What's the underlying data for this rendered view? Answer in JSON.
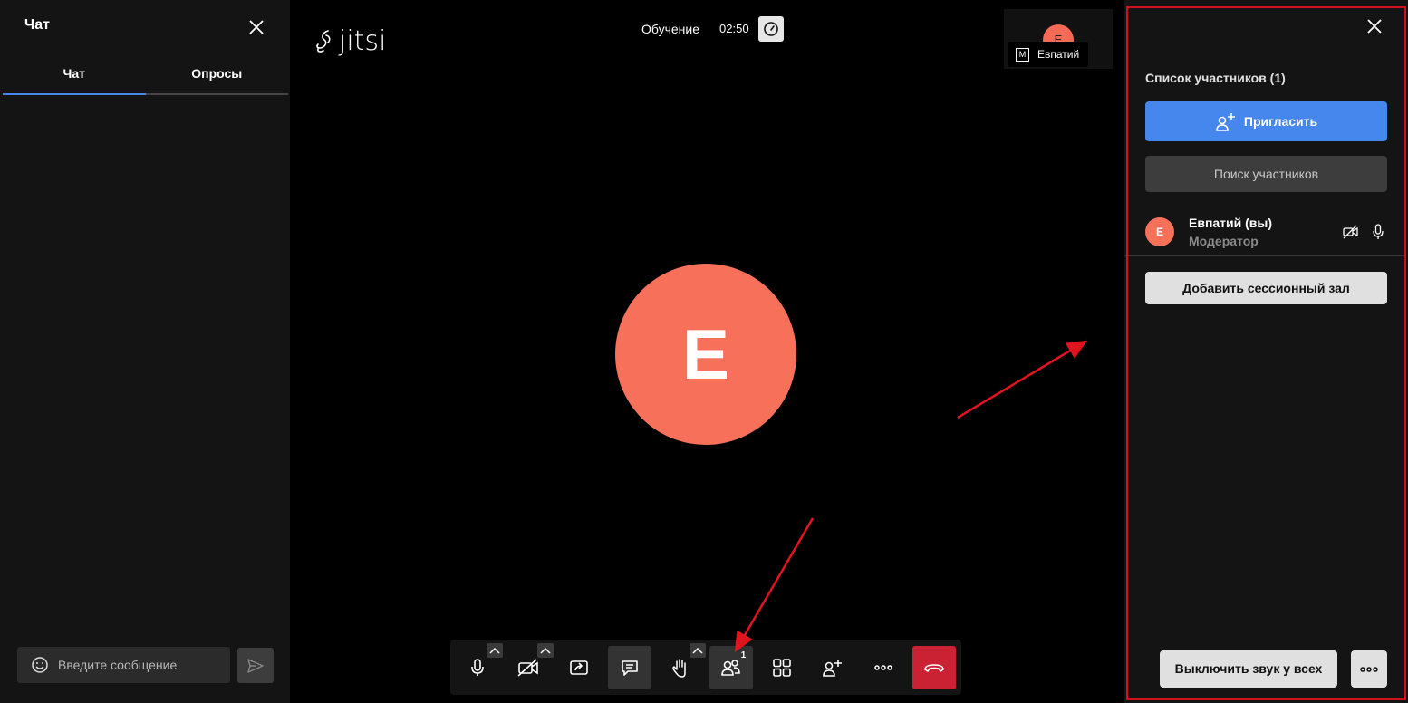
{
  "chat": {
    "title": "Чат",
    "tabs": [
      {
        "label": "Чат",
        "active": true
      },
      {
        "label": "Опросы",
        "active": false
      }
    ],
    "input_placeholder": "Введите сообщение"
  },
  "stage": {
    "logo_text": "jitsi",
    "meeting_name": "Обучение",
    "timer": "02:50",
    "thumbnail": {
      "avatar_letter": "E",
      "moderator_badge": "M",
      "name": "Евпатий"
    },
    "large_avatar_letter": "E"
  },
  "toolbar": {
    "participants_count": "1",
    "buttons": [
      "microphone",
      "camera",
      "screen-share",
      "chat",
      "raise-hand",
      "participants",
      "tile-view",
      "invite",
      "more",
      "hangup"
    ]
  },
  "participants_panel": {
    "header": "Список участников (1)",
    "invite_label": "Пригласить",
    "search_placeholder": "Поиск участников",
    "participant": {
      "avatar_letter": "E",
      "name": "Евпатий (вы)",
      "role": "Модератор"
    },
    "breakout_label": "Добавить сессионный зал",
    "mute_all_label": "Выключить звук у всех"
  },
  "colors": {
    "accent": "#4687ed",
    "avatar": "#f6705a",
    "hangup": "#cb2233",
    "annotation": "#d0101a"
  }
}
